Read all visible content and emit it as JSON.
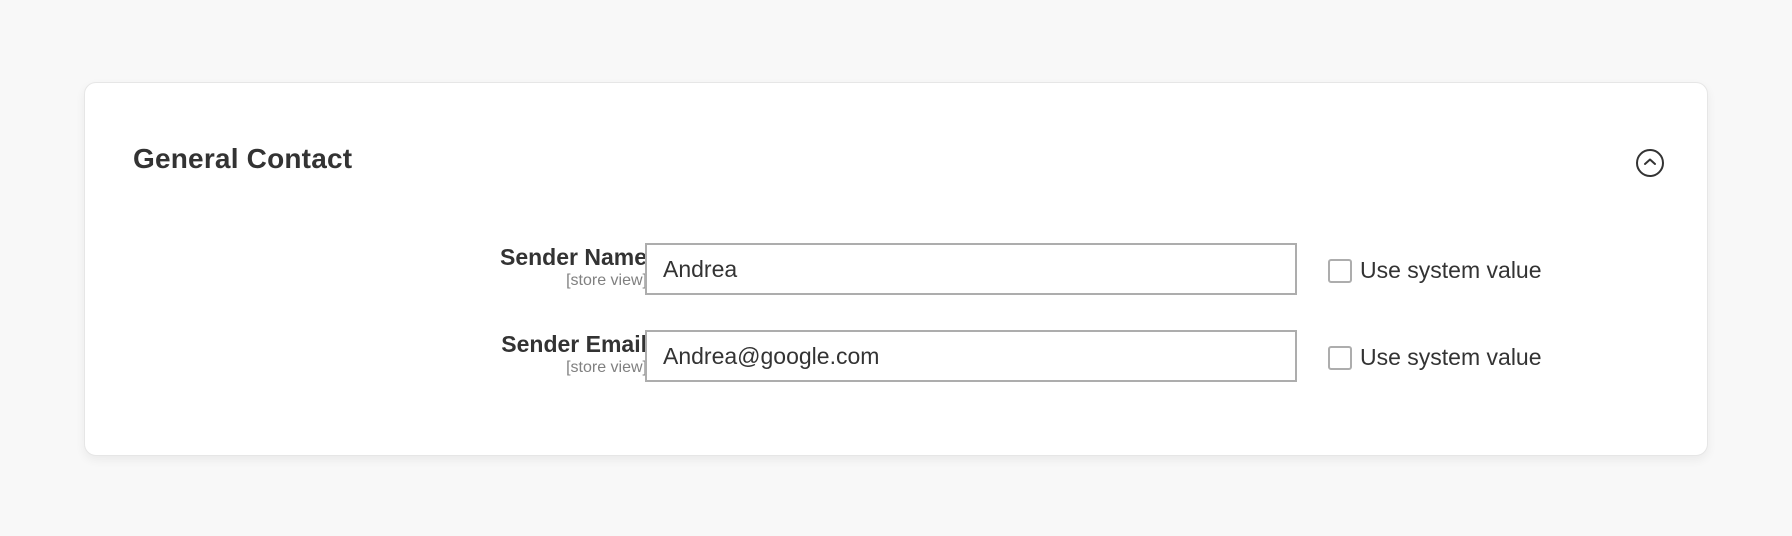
{
  "section": {
    "title": "General Contact",
    "toggle_icon": "chevron-up-circle-icon"
  },
  "fields": [
    {
      "label": "Sender Name",
      "scope": "[store view]",
      "value": "Andrea",
      "use_system_value_label": "Use system value",
      "use_system_value_checked": false
    },
    {
      "label": "Sender Email",
      "scope": "[store view]",
      "value": "Andrea@google.com",
      "use_system_value_label": "Use system value",
      "use_system_value_checked": false
    }
  ],
  "colors": {
    "page_background": "#f8f8f8",
    "card_background": "#ffffff",
    "text": "#333333",
    "scope_text": "#808080",
    "input_border": "#adadad"
  }
}
